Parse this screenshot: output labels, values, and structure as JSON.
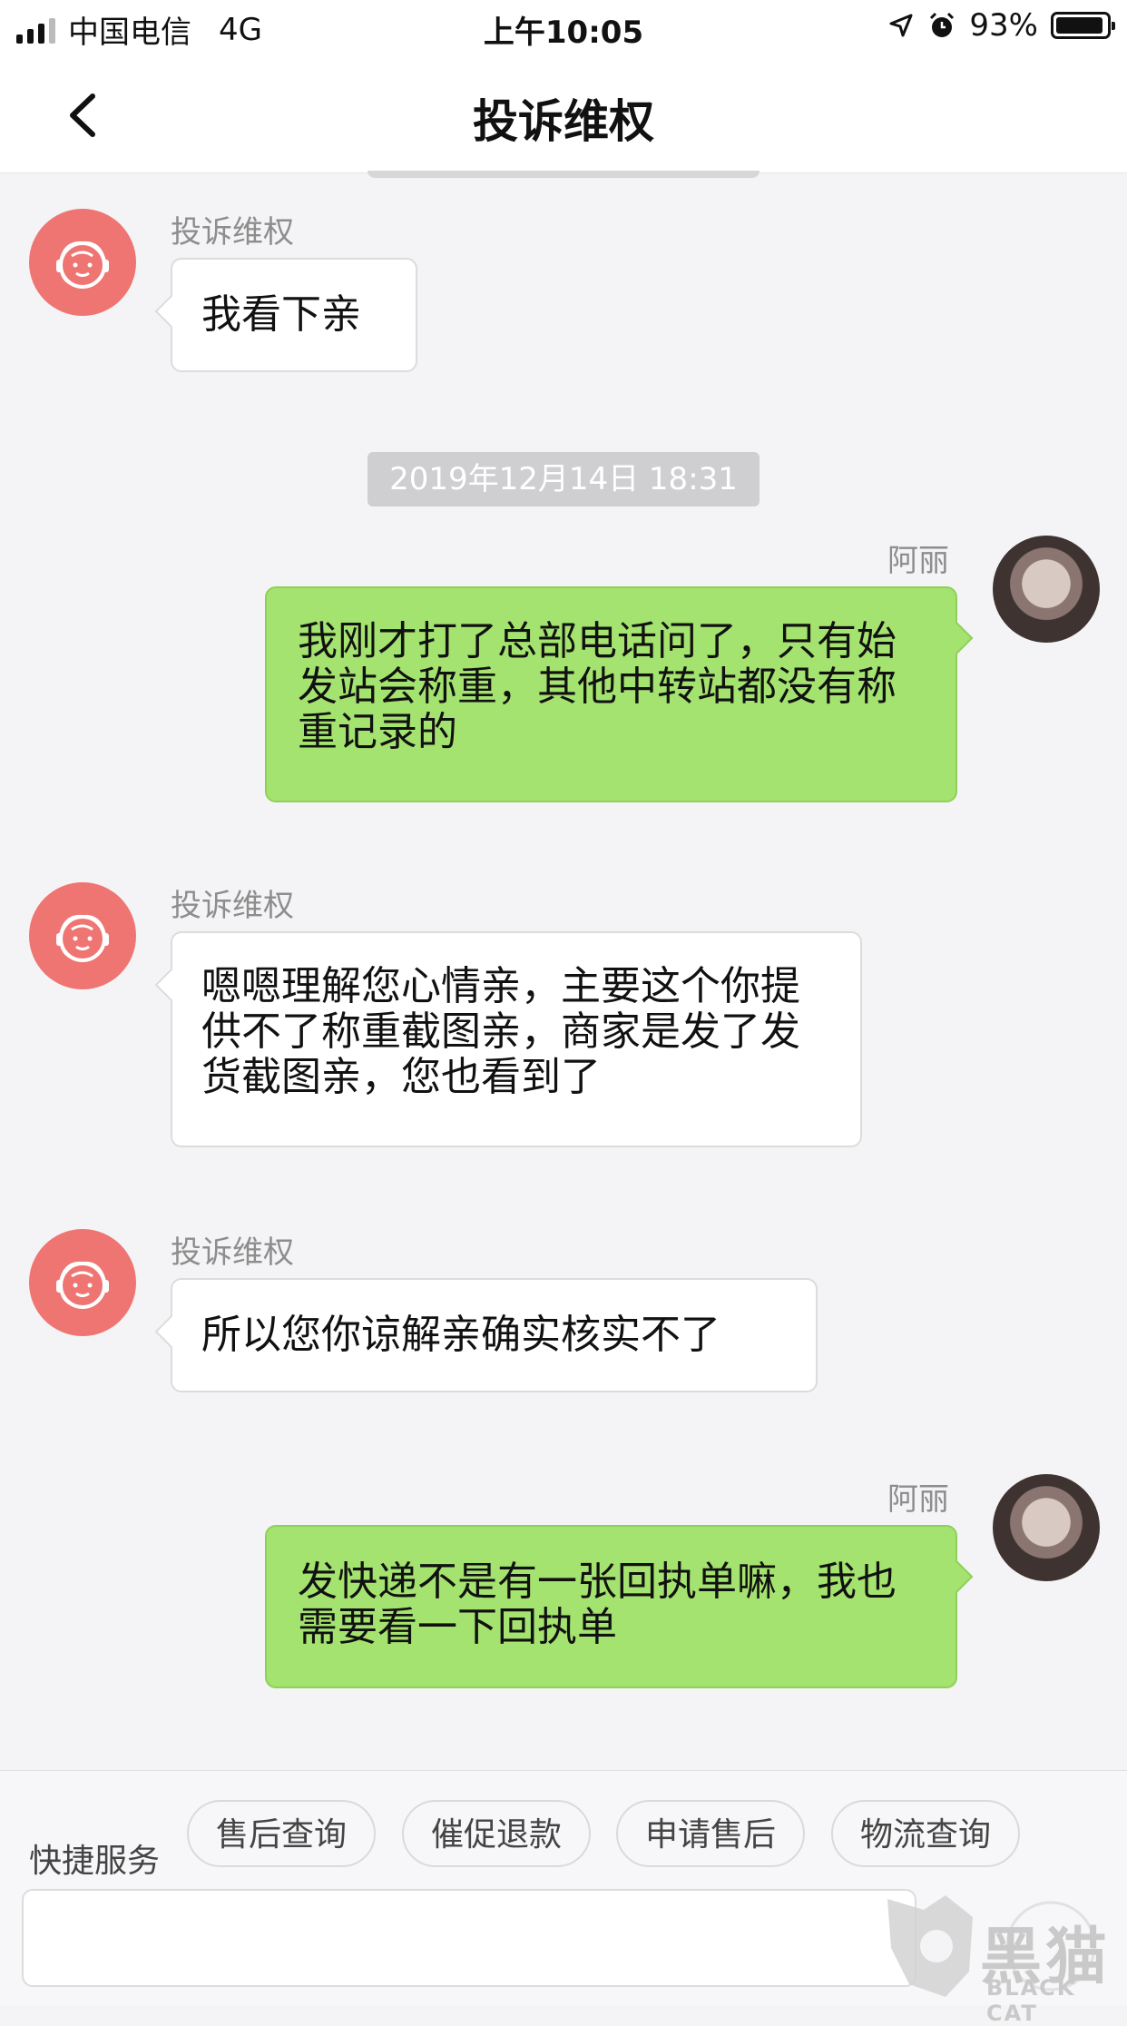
{
  "status_bar": {
    "carrier": "中国电信",
    "network": "4G",
    "time": "上午10:05",
    "battery_percent": "93%",
    "battery_level": 0.93
  },
  "nav": {
    "title": "投诉维权",
    "back_icon": "chevron-left-icon"
  },
  "messages": [
    {
      "side": "incoming",
      "sender": "投诉维权",
      "text": "我看下亲"
    },
    {
      "side": "outgoing",
      "sender": "阿丽",
      "text": "我刚才打了总部电话问了，只有始发站会称重，其他中转站都没有称重记录的"
    },
    {
      "side": "incoming",
      "sender": "投诉维权",
      "text": "嗯嗯理解您心情亲，主要这个你提供不了称重截图亲，商家是发了发货截图亲，您也看到了"
    },
    {
      "side": "incoming",
      "sender": "投诉维权",
      "text": "所以您你谅解亲确实核实不了"
    },
    {
      "side": "outgoing",
      "sender": "阿丽",
      "text": "发快递不是有一张回执单嘛，我也需要看一下回执单"
    }
  ],
  "timestamp": "2019年12月14日 18:31",
  "quick_service": {
    "label": "快捷服务",
    "chips": [
      "售后查询",
      "催促退款",
      "申请售后",
      "物流查询"
    ]
  },
  "watermark": {
    "text": "黑猫",
    "subtext": "BLACK CAT"
  },
  "colors": {
    "outgoing_bubble": "#a4e36f",
    "incoming_bubble": "#ffffff",
    "cs_avatar": "#ef7573",
    "background": "#f4f4f6"
  }
}
